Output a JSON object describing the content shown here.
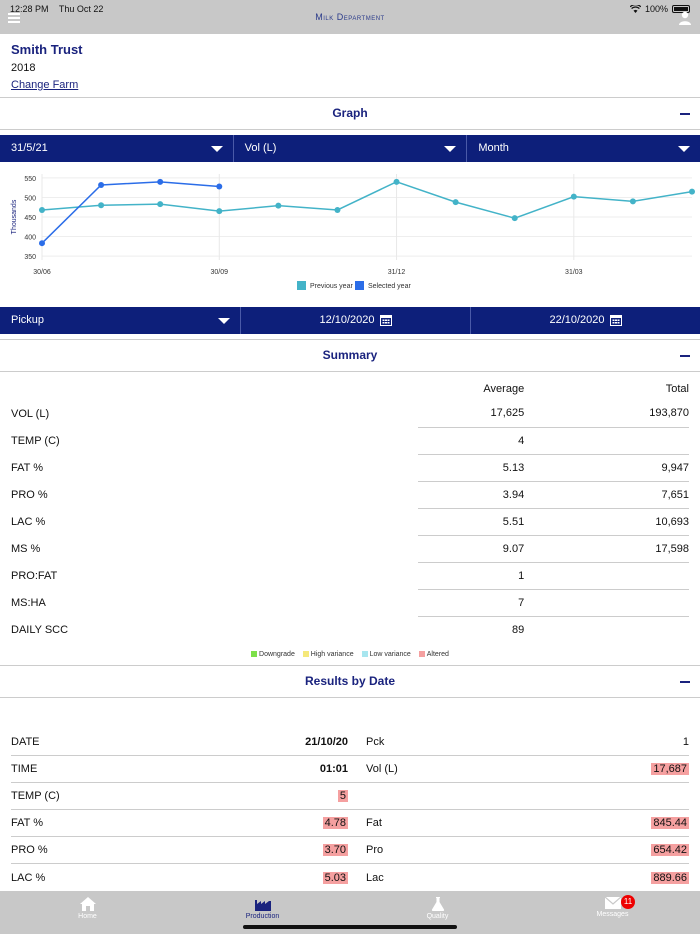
{
  "status": {
    "time": "12:28 PM",
    "date": "Thu Oct 22",
    "battery": "100%"
  },
  "app": {
    "title": "Milk Department"
  },
  "farm": {
    "name": "Smith Trust",
    "year": "2018",
    "change_link": "Change Farm"
  },
  "graph": {
    "title": "Graph",
    "selectors": {
      "date": "31/5/21",
      "metric": "Vol (L)",
      "period": "Month"
    }
  },
  "chart_data": {
    "type": "line",
    "ylabel": "Thousands",
    "yticks": [
      350,
      400,
      450,
      500,
      550
    ],
    "ylim": [
      340,
      560
    ],
    "x_tick_labels": [
      "30/06",
      "30/09",
      "31/12",
      "31/03"
    ],
    "x_tick_positions": [
      0,
      3,
      6,
      9
    ],
    "xlim": [
      0,
      11
    ],
    "grid": true,
    "legend_position": "bottom",
    "series": [
      {
        "name": "Previous year",
        "color": "#43b3c8",
        "x": [
          0,
          1,
          2,
          3,
          4,
          5,
          6,
          7,
          8,
          9,
          10,
          11
        ],
        "values": [
          468,
          480,
          483,
          465,
          479,
          468,
          540,
          488,
          447,
          502,
          490,
          515
        ]
      },
      {
        "name": "Selected year",
        "color": "#2b6de8",
        "x": [
          0,
          1,
          2,
          3
        ],
        "values": [
          383,
          532,
          540,
          528
        ]
      }
    ]
  },
  "pickup": {
    "label": "Pickup",
    "from": "12/10/2020",
    "to": "22/10/2020"
  },
  "summary": {
    "title": "Summary",
    "col_avg": "Average",
    "col_total": "Total",
    "rows": [
      {
        "label": "VOL (L)",
        "avg": "17,625",
        "total": "193,870"
      },
      {
        "label": "TEMP (C)",
        "avg": "4",
        "total": ""
      },
      {
        "label": "FAT  %",
        "avg": "5.13",
        "total": "9,947"
      },
      {
        "label": "PRO  %",
        "avg": "3.94",
        "total": "7,651"
      },
      {
        "label": "LAC  %",
        "avg": "5.51",
        "total": "10,693"
      },
      {
        "label": "MS  %",
        "avg": "9.07",
        "total": "17,598"
      },
      {
        "label": "PRO:FAT",
        "avg": "1",
        "total": ""
      },
      {
        "label": "MS:HA",
        "avg": "7",
        "total": ""
      },
      {
        "label": "DAILY SCC",
        "avg": "89",
        "total": ""
      }
    ],
    "legend": [
      {
        "label": "Downgrade",
        "color": "#7de04a"
      },
      {
        "label": "High variance",
        "color": "#f5e87a"
      },
      {
        "label": "Low variance",
        "color": "#a8e6ef"
      },
      {
        "label": "Altered",
        "color": "#f5a0a0"
      }
    ]
  },
  "results": {
    "title": "Results by Date",
    "rows": [
      {
        "l1": "DATE",
        "v1": "21/10/20",
        "v1_style": "bold",
        "l2": "Pck",
        "v2": "1",
        "v2_style": ""
      },
      {
        "l1": "TIME",
        "v1": "01:01",
        "v1_style": "bold",
        "l2": "Vol (L)",
        "v2": "17,687",
        "v2_style": "hl"
      },
      {
        "l1": "TEMP (C)",
        "v1": "5",
        "v1_style": "hl",
        "l2": "",
        "v2": "",
        "v2_style": ""
      },
      {
        "l1": "FAT  %",
        "v1": "4.78",
        "v1_style": "hl",
        "l2": "Fat",
        "v2": "845.44",
        "v2_style": "hl"
      },
      {
        "l1": "PRO  %",
        "v1": "3.70",
        "v1_style": "hl",
        "l2": "Pro",
        "v2": "654.42",
        "v2_style": "hl"
      },
      {
        "l1": "LAC  %",
        "v1": "5.03",
        "v1_style": "hl",
        "l2": "Lac",
        "v2": "889.66",
        "v2_style": "hl"
      }
    ]
  },
  "tabs": [
    {
      "label": "Home",
      "icon": "home-icon"
    },
    {
      "label": "Production",
      "icon": "factory-icon"
    },
    {
      "label": "Quality",
      "icon": "flask-icon"
    },
    {
      "label": "Messages",
      "icon": "envelope-icon",
      "badge": "11"
    }
  ]
}
